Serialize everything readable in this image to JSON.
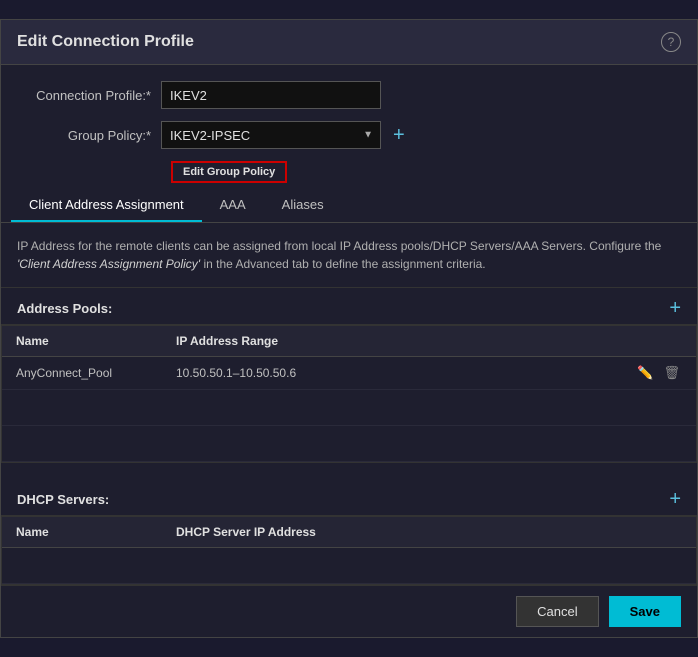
{
  "dialog": {
    "title": "Edit Connection Profile",
    "help_label": "?"
  },
  "form": {
    "connection_profile_label": "Connection Profile:*",
    "connection_profile_value": "IKEV2",
    "group_policy_label": "Group Policy:*",
    "group_policy_value": "IKEV2-IPSEC",
    "group_policy_options": [
      "IKEV2-IPSEC"
    ],
    "edit_group_policy_label": "Edit Group Policy",
    "add_button_label": "+"
  },
  "tabs": [
    {
      "id": "client-address",
      "label": "Client Address Assignment",
      "active": true
    },
    {
      "id": "aaa",
      "label": "AAA",
      "active": false
    },
    {
      "id": "aliases",
      "label": "Aliases",
      "active": false
    }
  ],
  "description": {
    "text1": "IP Address for the remote clients can be assigned from local IP Address pools/DHCP Servers/AAA",
    "text2": "Servers. Configure the ",
    "italic": "'Client Address Assignment Policy'",
    "text3": " in the Advanced tab to define the",
    "text4": "assignment criteria."
  },
  "address_pools": {
    "section_title": "Address Pools:",
    "add_icon": "+",
    "columns": [
      "Name",
      "IP Address Range",
      ""
    ],
    "rows": [
      {
        "name": "AnyConnect_Pool",
        "ip_range": "10.50.50.1~10.50.50.6"
      }
    ]
  },
  "dhcp_servers": {
    "section_title": "DHCP Servers:",
    "add_icon": "+",
    "columns": [
      "Name",
      "DHCP Server IP Address",
      ""
    ],
    "rows": []
  },
  "footer": {
    "cancel_label": "Cancel",
    "save_label": "Save"
  }
}
